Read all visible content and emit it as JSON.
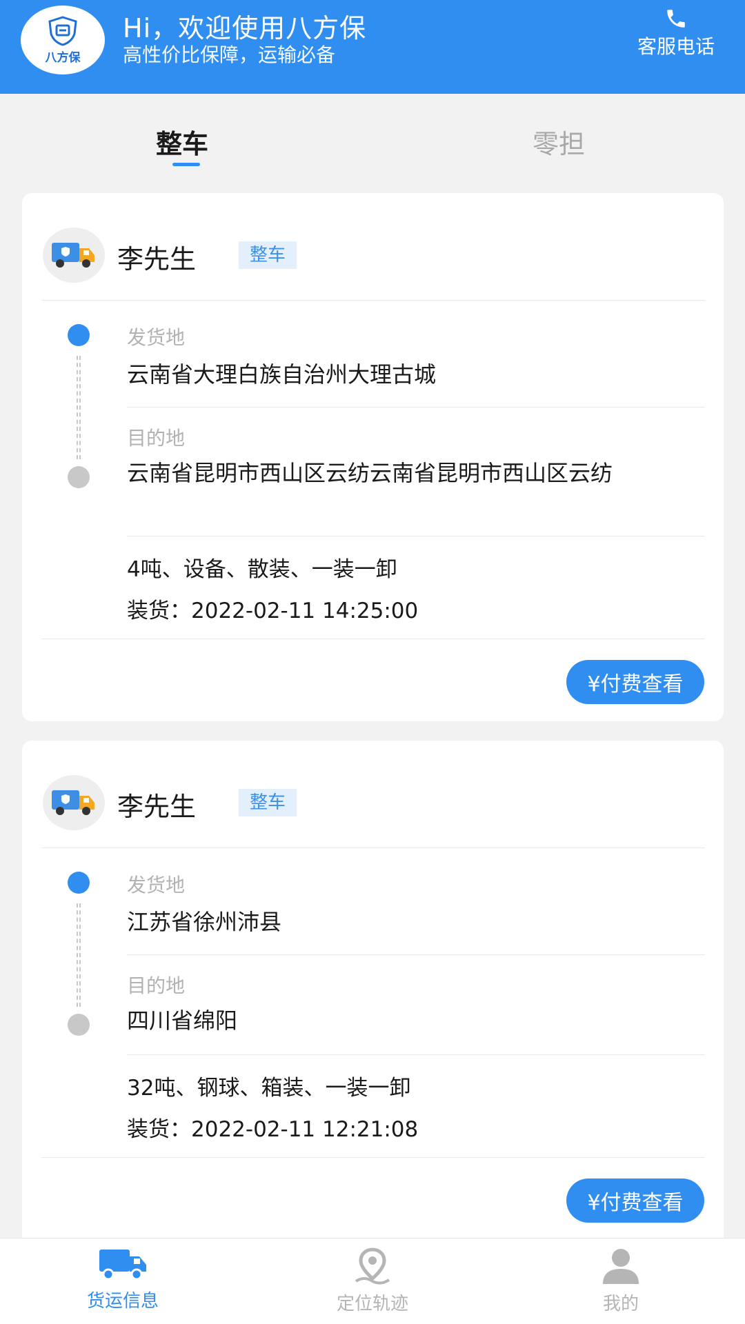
{
  "header": {
    "logo_text": "八方保",
    "greeting": "Hi，欢迎使用八方保",
    "slogan": "高性价比保障，运输必备",
    "service_label": "客服电话"
  },
  "tabs": [
    {
      "label": "整车",
      "active": true
    },
    {
      "label": "零担",
      "active": false
    }
  ],
  "labels": {
    "origin": "发货地",
    "destination": "目的地",
    "pay_button": "¥付费查看"
  },
  "cards": [
    {
      "name": "李先生",
      "type": "整车",
      "origin": "云南省大理白族自治州大理古城",
      "destination": "云南省昆明市西山区云纺云南省昆明市西山区云纺",
      "details": "4吨、设备、散装、一装一卸",
      "loading": "装货：2022-02-11 14:25:00"
    },
    {
      "name": "李先生",
      "type": "整车",
      "origin": "江苏省徐州沛县",
      "destination": "四川省绵阳",
      "details": "32吨、钢球、箱装、一装一卸",
      "loading": "装货：2022-02-11 12:21:08"
    }
  ],
  "bottom_nav": [
    {
      "label": "货运信息",
      "icon": "truck-icon",
      "active": true
    },
    {
      "label": "定位轨迹",
      "icon": "location-pin-icon",
      "active": false
    },
    {
      "label": "我的",
      "icon": "user-icon",
      "active": false
    }
  ],
  "colors": {
    "primary": "#2f8ef0",
    "background": "#f2f2f2",
    "badge_bg": "#e3f0fc",
    "inactive": "#b5b5b5"
  }
}
